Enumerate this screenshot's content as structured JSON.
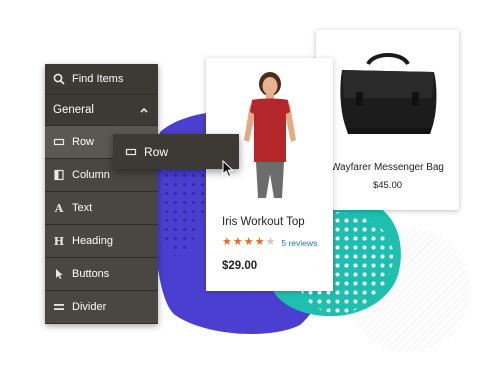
{
  "panel": {
    "search": {
      "label": "Find Items",
      "icon": "search-icon"
    },
    "group": {
      "label": "General",
      "state": "expanded",
      "icon": "chevron-up-icon"
    },
    "items": [
      {
        "label": "Row",
        "icon": "row-icon"
      },
      {
        "label": "Column",
        "icon": "column-icon"
      },
      {
        "label": "Text",
        "icon": "text-icon"
      },
      {
        "label": "Heading",
        "icon": "heading-icon"
      },
      {
        "label": "Buttons",
        "icon": "cursor-icon"
      },
      {
        "label": "Divider",
        "icon": "divider-icon"
      }
    ]
  },
  "drag": {
    "label": "Row",
    "icon": "row-icon"
  },
  "products": {
    "bag": {
      "name": "Wayfarer Messenger Bag",
      "price": "$45.00"
    },
    "top": {
      "name": "Iris Workout Top",
      "rating": 4,
      "rating_max": 5,
      "reviews": "5 reviews",
      "price": "$29.00"
    }
  },
  "colors": {
    "panel": "#3d3935",
    "blob_blue": "#4b3fd1",
    "blob_teal": "#1fbfb0",
    "star_on": "#e96a24",
    "link": "#1979c3"
  }
}
